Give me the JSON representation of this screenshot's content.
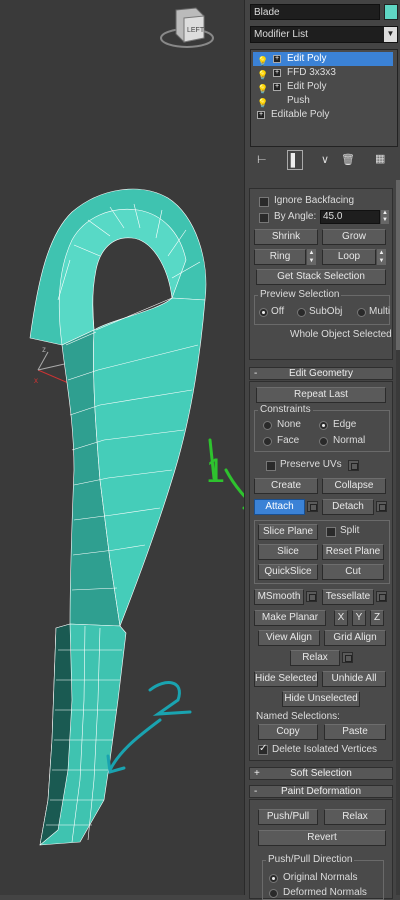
{
  "viewport": {
    "viewcube_label": "LEFT",
    "annotation_1": "1",
    "annotation_2": "2"
  },
  "panel": {
    "object_name": "Blade",
    "object_color": "#5fd6c4",
    "modifier_list_label": "Modifier List",
    "stack": [
      {
        "label": "Edit Poly",
        "selected": true
      },
      {
        "label": "FFD 3x3x3",
        "selected": false
      },
      {
        "label": "Edit Poly",
        "selected": false
      },
      {
        "label": "Push",
        "selected": false
      },
      {
        "label": "Editable Poly",
        "selected": false
      }
    ],
    "selection": {
      "ignore_backfacing": "Ignore Backfacing",
      "by_angle": "By Angle:",
      "angle_value": "45.0",
      "shrink": "Shrink",
      "grow": "Grow",
      "ring": "Ring",
      "loop": "Loop",
      "get_stack_selection": "Get Stack Selection",
      "preview_selection": "Preview Selection",
      "preview_off": "Off",
      "preview_subobj": "SubObj",
      "preview_multi": "Multi",
      "status": "Whole Object Selected"
    },
    "edit_geometry": {
      "title": "Edit Geometry",
      "collapse_sign": "-",
      "repeat_last": "Repeat Last",
      "constraints": "Constraints",
      "c_none": "None",
      "c_edge": "Edge",
      "c_face": "Face",
      "c_normal": "Normal",
      "preserve_uvs": "Preserve UVs",
      "create": "Create",
      "collapse": "Collapse",
      "attach": "Attach",
      "detach": "Detach",
      "slice_plane": "Slice Plane",
      "split": "Split",
      "slice": "Slice",
      "reset_plane": "Reset Plane",
      "quickslice": "QuickSlice",
      "cut": "Cut",
      "msmooth": "MSmooth",
      "tessellate": "Tessellate",
      "make_planar": "Make Planar",
      "x": "X",
      "y": "Y",
      "z": "Z",
      "view_align": "View Align",
      "grid_align": "Grid Align",
      "relax": "Relax",
      "hide_selected": "Hide Selected",
      "unhide_all": "Unhide All",
      "hide_unselected": "Hide Unselected",
      "named_selections": "Named Selections:",
      "copy": "Copy",
      "paste": "Paste",
      "delete_isolated": "Delete Isolated Vertices"
    },
    "soft_selection": {
      "title": "Soft Selection",
      "sign": "+"
    },
    "paint_deformation": {
      "title": "Paint Deformation",
      "sign": "-",
      "push_pull": "Push/Pull",
      "relax": "Relax",
      "revert": "Revert",
      "direction": "Push/Pull Direction",
      "original_normals": "Original Normals",
      "deformed_normals": "Deformed Normals"
    }
  }
}
